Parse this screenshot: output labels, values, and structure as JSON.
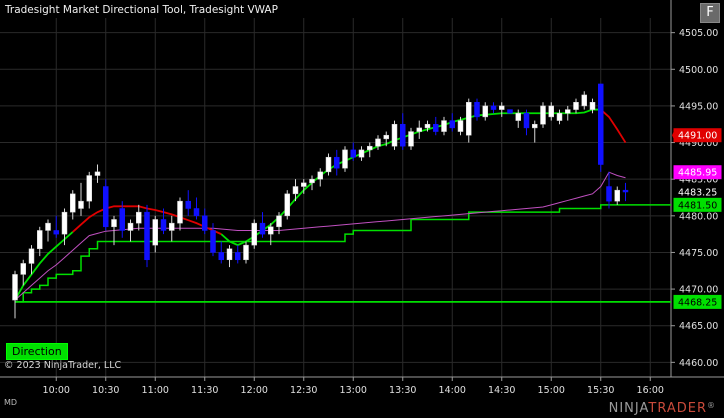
{
  "window": {
    "title": "Tradesight Market Directional Tool, Tradesight VWAP",
    "corner_button": "F",
    "direction_label": "Direction",
    "copyright": "© 2023 NinjaTrader, LLC",
    "md_label": "MD",
    "logo": {
      "part1": "NINJA",
      "part2": "TRADER",
      "registered": "®"
    }
  },
  "colors": {
    "background": "#000000",
    "grid": "#2a2a2a",
    "up_candle": "#ffffff",
    "down_candle": "#1010ff",
    "direction_up": "#00e000",
    "direction_down": "#e00000",
    "vwap": "#c050c0",
    "support": "#00e000"
  },
  "chart_data": {
    "type": "candlestick",
    "y_axis": {
      "range": [
        4458,
        4507
      ],
      "ticks": [
        4505,
        4500,
        4495,
        4490,
        4485,
        4480,
        4475,
        4470,
        4465,
        4460
      ],
      "tick_labels": [
        "4505.00",
        "4500.00",
        "4495.00",
        "4490.00",
        "4485.00",
        "4480.00",
        "4475.00",
        "4470.00",
        "4465.00",
        "4460.00"
      ]
    },
    "x_axis": {
      "time_labels": [
        "10:00",
        "10:30",
        "11:00",
        "11:30",
        "12:00",
        "12:30",
        "13:00",
        "13:30",
        "14:00",
        "14:30",
        "15:00",
        "15:30",
        "16:00"
      ],
      "first_bar_time": "09:35",
      "bar_minutes": 5,
      "label_start_index": 5,
      "label_step": 6
    },
    "candles": [
      [
        4468.5,
        4472.5,
        4466.0,
        4472.0
      ],
      [
        4472.0,
        4474.0,
        4470.5,
        4473.5
      ],
      [
        4473.5,
        4476.0,
        4472.0,
        4475.5
      ],
      [
        4475.5,
        4478.5,
        4474.5,
        4478.0
      ],
      [
        4478.0,
        4479.5,
        4476.5,
        4479.0
      ],
      [
        4478.0,
        4480.0,
        4477.0,
        4477.5
      ],
      [
        4477.5,
        4481.0,
        4476.0,
        4480.5
      ],
      [
        4480.5,
        4483.5,
        4479.5,
        4483.0
      ],
      [
        4481.0,
        4484.5,
        4480.0,
        4482.0
      ],
      [
        4482.0,
        4486.0,
        4481.0,
        4485.5
      ],
      [
        4485.5,
        4487.0,
        4484.5,
        4486.0
      ],
      [
        4484.0,
        4485.0,
        4478.0,
        4478.5
      ],
      [
        4478.5,
        4480.0,
        4476.0,
        4479.5
      ],
      [
        4481.0,
        4482.0,
        4477.0,
        4478.0
      ],
      [
        4478.0,
        4479.5,
        4476.5,
        4479.0
      ],
      [
        4479.0,
        4481.5,
        4478.0,
        4480.5
      ],
      [
        4480.5,
        4481.5,
        4473.0,
        4474.0
      ],
      [
        4476.0,
        4480.0,
        4475.0,
        4479.5
      ],
      [
        4479.5,
        4481.0,
        4477.5,
        4478.0
      ],
      [
        4478.0,
        4480.0,
        4476.5,
        4479.0
      ],
      [
        4479.0,
        4482.5,
        4478.0,
        4482.0
      ],
      [
        4482.0,
        4483.5,
        4480.0,
        4481.0
      ],
      [
        4481.0,
        4482.5,
        4479.5,
        4480.0
      ],
      [
        4480.0,
        4481.0,
        4477.5,
        4478.0
      ],
      [
        4478.0,
        4479.0,
        4474.5,
        4475.0
      ],
      [
        4475.0,
        4476.5,
        4473.5,
        4474.0
      ],
      [
        4474.0,
        4476.0,
        4473.0,
        4475.5
      ],
      [
        4475.0,
        4476.0,
        4473.5,
        4474.0
      ],
      [
        4474.0,
        4476.5,
        4473.5,
        4476.0
      ],
      [
        4476.0,
        4479.5,
        4475.5,
        4479.0
      ],
      [
        4479.0,
        4480.5,
        4477.0,
        4477.5
      ],
      [
        4477.5,
        4479.0,
        4476.0,
        4478.5
      ],
      [
        4478.5,
        4480.5,
        4477.5,
        4480.0
      ],
      [
        4480.0,
        4483.5,
        4479.5,
        4483.0
      ],
      [
        4483.0,
        4485.0,
        4482.0,
        4484.0
      ],
      [
        4484.0,
        4485.0,
        4483.0,
        4484.5
      ],
      [
        4484.5,
        4485.5,
        4483.5,
        4485.0
      ],
      [
        4485.0,
        4486.5,
        4484.0,
        4486.0
      ],
      [
        4486.0,
        4488.5,
        4485.5,
        4488.0
      ],
      [
        4488.0,
        4489.0,
        4485.5,
        4486.5
      ],
      [
        4486.5,
        4489.5,
        4486.0,
        4489.0
      ],
      [
        4489.0,
        4490.0,
        4487.5,
        4488.0
      ],
      [
        4488.0,
        4489.5,
        4487.5,
        4489.0
      ],
      [
        4489.0,
        4490.0,
        4488.0,
        4489.5
      ],
      [
        4489.5,
        4491.0,
        4489.0,
        4490.5
      ],
      [
        4490.5,
        4491.5,
        4489.5,
        4491.0
      ],
      [
        4489.5,
        4493.0,
        4489.0,
        4492.5
      ],
      [
        4492.5,
        4494.0,
        4489.0,
        4489.5
      ],
      [
        4489.5,
        4492.0,
        4489.0,
        4491.5
      ],
      [
        4491.5,
        4493.0,
        4490.5,
        4492.0
      ],
      [
        4492.0,
        4493.0,
        4491.5,
        4492.5
      ],
      [
        4492.5,
        4493.5,
        4491.0,
        4491.5
      ],
      [
        4491.5,
        4493.5,
        4491.0,
        4493.0
      ],
      [
        4493.0,
        4494.0,
        4491.5,
        4492.0
      ],
      [
        4491.5,
        4493.5,
        4491.0,
        4493.0
      ],
      [
        4491.0,
        4496.0,
        4490.0,
        4495.5
      ],
      [
        4495.5,
        4496.0,
        4493.0,
        4493.5
      ],
      [
        4493.5,
        4495.5,
        4493.0,
        4495.0
      ],
      [
        4495.0,
        4495.5,
        4494.0,
        4494.5
      ],
      [
        4494.5,
        4495.5,
        4493.5,
        4495.0
      ],
      [
        4494.5,
        4494.5,
        4494.0,
        4494.0
      ],
      [
        4493.0,
        4494.5,
        4492.0,
        4494.0
      ],
      [
        4494.0,
        4494.5,
        4491.0,
        4492.0
      ],
      [
        4492.0,
        4493.0,
        4490.0,
        4492.5
      ],
      [
        4492.5,
        4495.5,
        4492.0,
        4495.0
      ],
      [
        4493.5,
        4495.5,
        4493.0,
        4495.0
      ],
      [
        4493.0,
        4494.5,
        4492.5,
        4494.0
      ],
      [
        4494.0,
        4495.0,
        4493.0,
        4494.5
      ],
      [
        4494.5,
        4496.0,
        4494.0,
        4495.5
      ],
      [
        4495.0,
        4497.0,
        4494.5,
        4496.5
      ],
      [
        4494.5,
        4496.0,
        4494.0,
        4495.5
      ],
      [
        4498.0,
        4498.0,
        4486.0,
        4487.0
      ],
      [
        4484.0,
        4486.0,
        4481.0,
        4482.0
      ],
      [
        4482.0,
        4484.0,
        4481.5,
        4483.5
      ],
      [
        4483.5,
        4484.5,
        4482.0,
        4483.25
      ]
    ],
    "series": [
      {
        "name": "direction",
        "up_ranges": [
          [
            0,
            7
          ],
          [
            25,
            71
          ]
        ],
        "down_ranges": [
          [
            7,
            25
          ],
          [
            71,
            74
          ]
        ],
        "values": [
          4468.5,
          4470.5,
          4472.0,
          4473.5,
          4474.8,
          4475.8,
          4476.8,
          4477.8,
          4478.8,
          4479.8,
          4480.5,
          4481.0,
          4481.3,
          4481.3,
          4481.3,
          4481.3,
          4481.0,
          4480.8,
          4480.5,
          4480.2,
          4479.8,
          4479.4,
          4479.0,
          4478.5,
          4478.0,
          4477.5,
          4476.5,
          4476.0,
          4476.5,
          4477.2,
          4478.0,
          4478.8,
          4479.8,
          4481.0,
          4482.3,
          4483.5,
          4484.5,
          4485.5,
          4486.3,
          4487.0,
          4487.5,
          4488.0,
          4488.5,
          4489.0,
          4489.5,
          4489.8,
          4490.3,
          4490.7,
          4491.1,
          4491.5,
          4491.8,
          4492.1,
          4492.4,
          4492.8,
          4493.1,
          4493.4,
          4493.7,
          4493.8,
          4493.9,
          4494.0,
          4494.0,
          4494.0,
          4494.0,
          4494.0,
          4494.0,
          4494.0,
          4494.0,
          4494.0,
          4494.0,
          4494.1,
          4494.5,
          4494.5,
          4493.5,
          4491.8,
          4490.0
        ]
      },
      {
        "name": "vwap",
        "values": [
          4468.5,
          4469.5,
          4470.5,
          4471.5,
          4472.5,
          4473.3,
          4474.3,
          4475.3,
          4476.3,
          4477.3,
          4477.6,
          4477.9,
          4478.0,
          4478.1,
          4478.2,
          4478.3,
          4478.3,
          4478.3,
          4478.3,
          4478.3,
          4478.3,
          4478.3,
          4478.3,
          4478.3,
          4478.3,
          4478.2,
          4478.1,
          4478.0,
          4478.0,
          4478.0,
          4478.0,
          4478.0,
          4478.0,
          4478.1,
          4478.2,
          4478.3,
          4478.4,
          4478.5,
          4478.6,
          4478.7,
          4478.8,
          4478.9,
          4479.0,
          4479.1,
          4479.2,
          4479.3,
          4479.4,
          4479.5,
          4479.6,
          4479.7,
          4479.8,
          4479.9,
          4480.0,
          4480.1,
          4480.2,
          4480.3,
          4480.4,
          4480.5,
          4480.6,
          4480.7,
          4480.8,
          4480.9,
          4481.0,
          4481.1,
          4481.2,
          4481.5,
          4481.8,
          4482.1,
          4482.4,
          4482.7,
          4483.0,
          4484.0,
          4485.95,
          4485.5,
          4485.2
        ]
      },
      {
        "name": "support",
        "values": [
          4468.25,
          4469.5,
          4470.0,
          4470.5,
          4471.5,
          4472.0,
          4472.0,
          4472.5,
          4474.5,
          4475.5,
          4476.5,
          4476.5,
          4476.5,
          4476.5,
          4476.5,
          4476.5,
          4476.5,
          4476.5,
          4476.5,
          4476.5,
          4476.5,
          4476.5,
          4476.5,
          4476.5,
          4476.5,
          4476.5,
          4476.5,
          4476.5,
          4476.5,
          4476.5,
          4476.5,
          4476.5,
          4476.5,
          4476.5,
          4476.5,
          4476.5,
          4476.5,
          4476.5,
          4476.5,
          4476.5,
          4477.5,
          4478.0,
          4478.0,
          4478.0,
          4478.0,
          4478.0,
          4478.0,
          4478.0,
          4479.5,
          4479.5,
          4479.5,
          4479.5,
          4479.5,
          4479.5,
          4479.5,
          4480.5,
          4480.5,
          4480.5,
          4480.5,
          4480.5,
          4480.5,
          4480.5,
          4480.5,
          4480.5,
          4480.5,
          4480.5,
          4481.0,
          4481.0,
          4481.0,
          4481.0,
          4481.0,
          4481.5,
          4481.5,
          4481.5,
          4481.5
        ]
      },
      {
        "name": "opening_level",
        "value": 4468.25
      }
    ],
    "price_labels": [
      {
        "value": 4491.0,
        "text": "4491.00",
        "bg": "#e00000",
        "fg": "#ffffff"
      },
      {
        "value": 4485.95,
        "text": "4485.95",
        "bg": "#ff00ff",
        "fg": "#ffffff"
      },
      {
        "value": 4483.25,
        "text": "4483.25",
        "bg": "#000000",
        "fg": "#ffffff"
      },
      {
        "value": 4481.5,
        "text": "4481.50",
        "bg": "#00e000",
        "fg": "#000000"
      },
      {
        "value": 4468.25,
        "text": "4468.25",
        "bg": "#00e000",
        "fg": "#000000"
      }
    ],
    "grid": true
  }
}
